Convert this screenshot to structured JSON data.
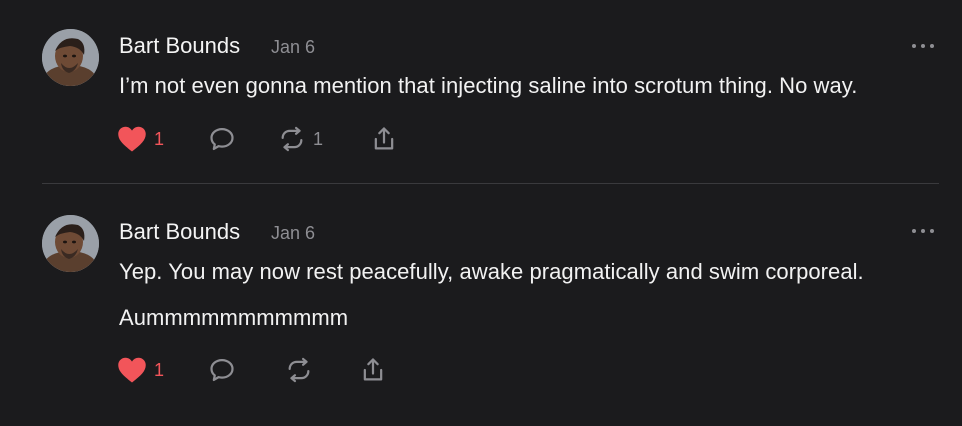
{
  "colors": {
    "background": "#1b1b1d",
    "text": "#f2f2f2",
    "muted": "#8e8e93",
    "like": "#f2555a",
    "divider": "#3a3a3d"
  },
  "posts": [
    {
      "author": "Bart Bounds",
      "date": "Jan 6",
      "paragraphs": [
        "I’m not even gonna mention that injecting saline into scrotum thing. No way."
      ],
      "likes": "1",
      "liked": true,
      "restacks": "1",
      "icons": [
        "heart-icon",
        "comment-icon",
        "restack-icon",
        "share-icon",
        "more-icon"
      ]
    },
    {
      "author": "Bart Bounds",
      "date": "Jan 6",
      "paragraphs": [
        "Yep. You may now rest peacefully, awake pragmatically and swim corporeal.",
        "Aummmmmmmmmmm"
      ],
      "likes": "1",
      "liked": true,
      "restacks": "",
      "icons": [
        "heart-icon",
        "comment-icon",
        "restack-icon",
        "share-icon",
        "more-icon"
      ]
    }
  ]
}
